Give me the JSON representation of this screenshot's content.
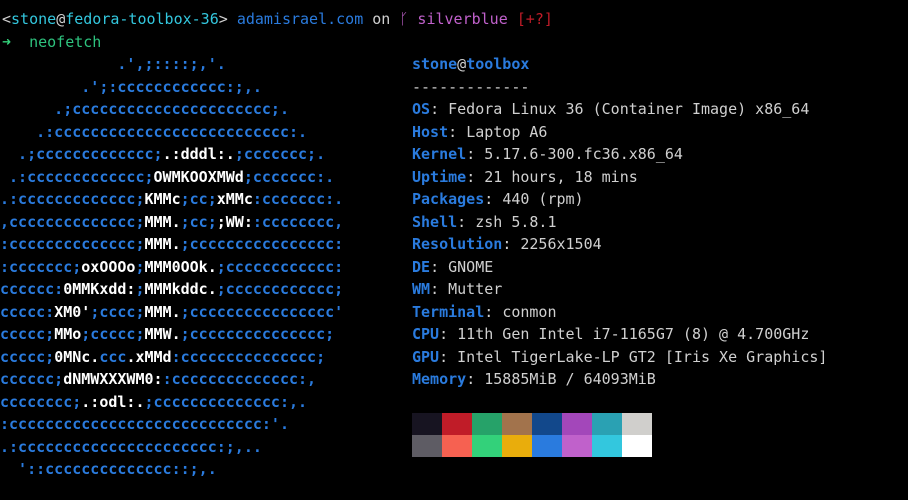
{
  "prompt": {
    "user": "stone",
    "at": "@",
    "host": "fedora-toolbox-36",
    "arrow": ">",
    "path": "adamisrael.com",
    "on": "on",
    "branch_icon": "git-branch-icon",
    "branch_glyph": "ᚴ",
    "branch": "silverblue",
    "status": "[+?]"
  },
  "command": {
    "arrow": "➜",
    "text": "neofetch"
  },
  "logo": [
    [
      [
        "b",
        "             .',;::::;,'."
      ]
    ],
    [
      [
        "b",
        "         .';:cccccccccccc:;,."
      ]
    ],
    [
      [
        "b",
        "      .;cccccccccccccccccccccc;."
      ]
    ],
    [
      [
        "b",
        "    .:cccccccccccccccccccccccccc:."
      ]
    ],
    [
      [
        "b",
        "  .;ccccccccccccc;"
      ],
      [
        "w",
        ".:dddl:."
      ],
      [
        "b",
        ";ccccccc;."
      ]
    ],
    [
      [
        "b",
        " .:ccccccccccccc;"
      ],
      [
        "w",
        "OWMKOOXMWd"
      ],
      [
        "b",
        ";ccccccc:."
      ]
    ],
    [
      [
        "b",
        ".:ccccccccccccc;"
      ],
      [
        "w",
        "KMMc"
      ],
      [
        "b",
        ";cc;"
      ],
      [
        "w",
        "xMMc"
      ],
      [
        "b",
        ":ccccccc:."
      ]
    ],
    [
      [
        "b",
        ",cccccccccccccc;"
      ],
      [
        "w",
        "MMM."
      ],
      [
        "b",
        ";cc;"
      ],
      [
        "w",
        ";WW:"
      ],
      [
        "b",
        ":cccccccc,"
      ]
    ],
    [
      [
        "b",
        ":cccccccccccccc;"
      ],
      [
        "w",
        "MMM."
      ],
      [
        "b",
        ";cccccccccccccccc:"
      ]
    ],
    [
      [
        "b",
        ":ccccccc;"
      ],
      [
        "w",
        "oxOOOo"
      ],
      [
        "b",
        ";"
      ],
      [
        "w",
        "MMM0OOk."
      ],
      [
        "b",
        ";cccccccccccc:"
      ]
    ],
    [
      [
        "b",
        "cccccc:"
      ],
      [
        "w",
        "0MMKxdd:"
      ],
      [
        "b",
        ";"
      ],
      [
        "w",
        "MMMkddc."
      ],
      [
        "b",
        ";cccccccccccc;"
      ]
    ],
    [
      [
        "b",
        "ccccc:"
      ],
      [
        "w",
        "XM0'"
      ],
      [
        "b",
        ";cccc;"
      ],
      [
        "w",
        "MMM."
      ],
      [
        "b",
        ";cccccccccccccccc'"
      ]
    ],
    [
      [
        "b",
        "ccccc;"
      ],
      [
        "w",
        "MMo"
      ],
      [
        "b",
        ";ccccc;"
      ],
      [
        "w",
        "MMW."
      ],
      [
        "b",
        ";ccccccccccccccc;"
      ]
    ],
    [
      [
        "b",
        "ccccc;"
      ],
      [
        "w",
        "0MNc."
      ],
      [
        "b",
        "ccc"
      ],
      [
        "w",
        ".xMMd"
      ],
      [
        "b",
        ":ccccccccccccccc;"
      ]
    ],
    [
      [
        "b",
        "cccccc;"
      ],
      [
        "w",
        "dNMWXXXWM0:"
      ],
      [
        "b",
        ":cccccccccccccc:,"
      ]
    ],
    [
      [
        "b",
        "cccccccc;"
      ],
      [
        "w",
        ".:odl:."
      ],
      [
        "b",
        ";cccccccccccccc:,."
      ]
    ],
    [
      [
        "b",
        ":cccccccccccccccccccccccccccc:'."
      ]
    ],
    [
      [
        "b",
        ".:cccccccccccccccccccccc:;,.."
      ]
    ],
    [
      [
        "b",
        "  '::cccccccccccccc::;,."
      ]
    ]
  ],
  "sysinfo": {
    "header_user": "stone",
    "header_at": "@",
    "header_host": "toolbox",
    "separator": "-------------",
    "rows": [
      {
        "key": "OS",
        "value": "Fedora Linux 36 (Container Image) x86_64"
      },
      {
        "key": "Host",
        "value": "Laptop A6"
      },
      {
        "key": "Kernel",
        "value": "5.17.6-300.fc36.x86_64"
      },
      {
        "key": "Uptime",
        "value": "21 hours, 18 mins"
      },
      {
        "key": "Packages",
        "value": "440 (rpm)"
      },
      {
        "key": "Shell",
        "value": "zsh 5.8.1"
      },
      {
        "key": "Resolution",
        "value": "2256x1504"
      },
      {
        "key": "DE",
        "value": "GNOME"
      },
      {
        "key": "WM",
        "value": "Mutter"
      },
      {
        "key": "Terminal",
        "value": "conmon"
      },
      {
        "key": "CPU",
        "value": "11th Gen Intel i7-1165G7 (8) @ 4.700GHz"
      },
      {
        "key": "GPU",
        "value": "Intel TigerLake-LP GT2 [Iris Xe Graphics]"
      },
      {
        "key": "Memory",
        "value": "15885MiB / 64093MiB"
      }
    ]
  },
  "palette": {
    "normal": [
      "#171421",
      "#c01c28",
      "#26a269",
      "#a2734c",
      "#12488b",
      "#a347ba",
      "#2aa1b3",
      "#d0cfcc"
    ],
    "bright": [
      "#5e5c64",
      "#f66151",
      "#33d17a",
      "#e9ad0c",
      "#2a7bde",
      "#c061cb",
      "#33c7de",
      "#ffffff"
    ]
  }
}
